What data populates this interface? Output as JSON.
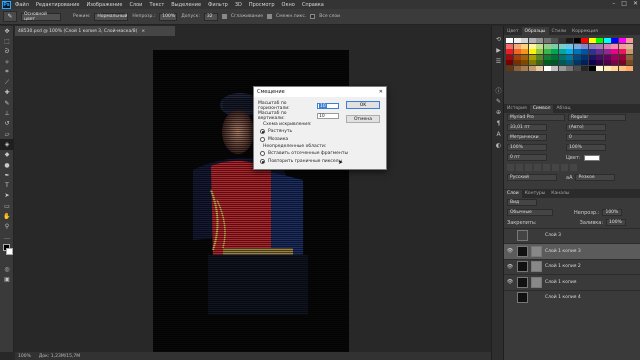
{
  "menubar": {
    "logo": "Ps",
    "items": [
      "Файл",
      "Редактирование",
      "Изображение",
      "Слои",
      "Текст",
      "Выделение",
      "Фильтр",
      "3D",
      "Просмотр",
      "Окно",
      "Справка"
    ],
    "window_controls": [
      "–",
      "□",
      "✕"
    ]
  },
  "options": {
    "preset_icon": "✎",
    "brush_label": "Основной цвет",
    "mode_label": "Режим:",
    "mode_value": "Нормальный",
    "opacity_label": "Непрозр.:",
    "opacity_value": "100%",
    "tolerance_label": "Допуск:",
    "tolerance_value": "32",
    "antialias_label": "Сглаживание",
    "contiguous_label": "Смежн.пикс.",
    "all_layers_label": "Все слои"
  },
  "document": {
    "tab_title": "48530.psd @ 100% (Слой 1 копия 3, Слой-маска/8)",
    "close": "×",
    "status_zoom": "100%",
    "status_doc": "Док: 1,23М/15,7М"
  },
  "dialog": {
    "title": "Смещение",
    "close": "✕",
    "h_label": "Масштаб по горизонтали:",
    "h_value": "10",
    "v_label": "Масштаб по вертикали:",
    "v_value": "10",
    "ok": "OK",
    "cancel": "Отмена",
    "displacement_map_label": "Схема искривления:",
    "stretch_label": "Растянуть",
    "tile_label": "Мозаика",
    "undefined_label": "Неопределенные области:",
    "wrap_label": "Вставить отсеченные фрагменты",
    "repeat_label": "Повторить граничные пикселы"
  },
  "swatches_panel": {
    "tabs": [
      "Цвет",
      "Образцы",
      "Стили",
      "Коррекция"
    ],
    "active": 1,
    "colors": [
      "#ffffff",
      "#f0f0f0",
      "#d6d6d6",
      "#b5b5b5",
      "#959595",
      "#737373",
      "#535353",
      "#333333",
      "#1a1a1a",
      "#000000",
      "#ff0000",
      "#ffff00",
      "#00ff00",
      "#00ffff",
      "#0000ff",
      "#ff00ff",
      "#f59a9a",
      "#f26b6b",
      "#f7a87a",
      "#fbd37d",
      "#fff799",
      "#c5df8a",
      "#95cc8d",
      "#7ccba2",
      "#7bcdc8",
      "#6fc6e9",
      "#7da8d8",
      "#8289c3",
      "#8e7cb8",
      "#a97bb7",
      "#d17fb5",
      "#f08fae",
      "#f29b9b",
      "#e5b2a0",
      "#ed1c24",
      "#f26522",
      "#f7941d",
      "#fff200",
      "#8dc63f",
      "#39b54a",
      "#00a651",
      "#00a99d",
      "#00aeef",
      "#0072bc",
      "#0054a6",
      "#2e3192",
      "#662d91",
      "#92278f",
      "#ec008c",
      "#ed145b",
      "#c69c6d",
      "#9e0b0f",
      "#a0410d",
      "#a3620a",
      "#aba000",
      "#598527",
      "#197b30",
      "#007236",
      "#00746b",
      "#0076a3",
      "#004a80",
      "#003471",
      "#1b1464",
      "#440e62",
      "#630460",
      "#9e005d",
      "#9e0039",
      "#8c6239",
      "#790000",
      "#7b2e00",
      "#7d4900",
      "#827b00",
      "#406618",
      "#005e20",
      "#005826",
      "#005952",
      "#005b7f",
      "#003663",
      "#002157",
      "#0d004c",
      "#32004b",
      "#4b0049",
      "#7b0046",
      "#7a0026",
      "#754c24",
      "#603913",
      "#8c6239",
      "#a67c52",
      "#c69c6d",
      "#e6c9a0",
      "#ffffff",
      "#c2c2c2",
      "#999999",
      "#737373",
      "#4d4d4d",
      "#262626",
      "#000000",
      "#fff6d5",
      "#ffe8b3",
      "#ffd699",
      "#ffc080",
      "#ffa766"
    ]
  },
  "character_panel": {
    "tabs": [
      "История",
      "Символ",
      "Абзац"
    ],
    "active": 1,
    "font_family": "Myriad Pro",
    "font_style": "Regular",
    "font_size": "33,01 пт",
    "leading": "(Авто)",
    "kerning": "Метрически",
    "tracking": "0",
    "v_scale": "100%",
    "h_scale": "100%",
    "baseline": "0 пт",
    "color_label": "Цвет:",
    "language": "Русский",
    "aa_method": "Резкое",
    "aa_icon": "aA"
  },
  "layers_panel": {
    "tabs": [
      "Слои",
      "Контуры",
      "Каналы"
    ],
    "active": 0,
    "filter_label": "Вид",
    "blend_mode": "Обычные",
    "opacity_label": "Непрозр.:",
    "opacity_value": "100%",
    "lock_label": "Закрепить:",
    "fill_label": "Заливка:",
    "fill_value": "100%",
    "layers": [
      {
        "name": "Слой 3",
        "visible": false,
        "mask": false,
        "selected": false
      },
      {
        "name": "Слой 1 копия 3",
        "visible": true,
        "mask": true,
        "selected": true
      },
      {
        "name": "Слой 1 копия 2",
        "visible": true,
        "mask": true,
        "selected": false
      },
      {
        "name": "Слой 1 копия",
        "visible": true,
        "mask": true,
        "selected": false
      },
      {
        "name": "Слой 1 копия 4",
        "visible": false,
        "mask": false,
        "selected": false
      }
    ]
  },
  "colors": {
    "accent": "#3c7fd6",
    "uniform_red": "#b3262c",
    "uniform_blue": "#1c2e63"
  },
  "icons": {
    "eye": "👁",
    "chain": "⛓"
  }
}
